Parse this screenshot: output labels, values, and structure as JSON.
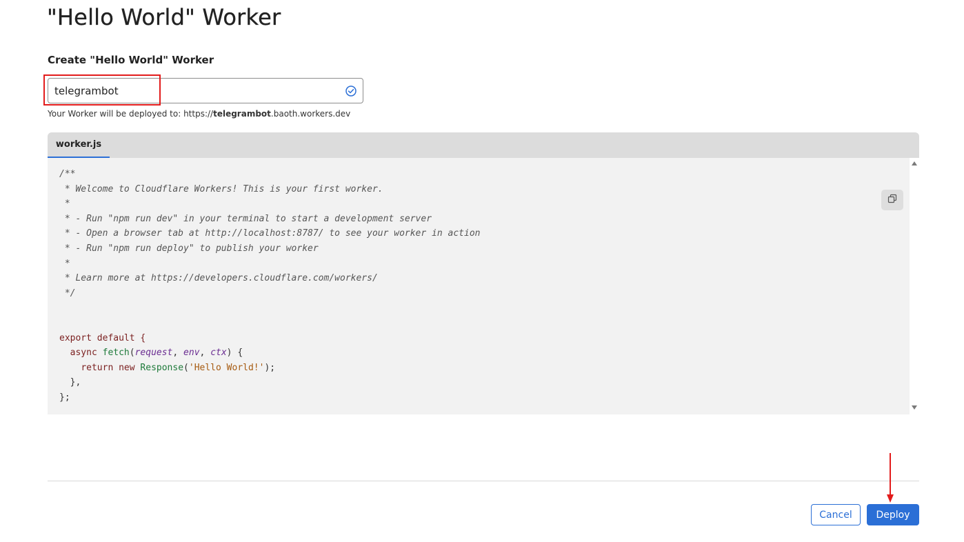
{
  "page": {
    "title": "\"Hello World\" Worker"
  },
  "form": {
    "section_label": "Create \"Hello World\" Worker",
    "worker_name_value": "telegrambot",
    "deploy_url_prefix": "Your Worker will be deployed to: https://",
    "deploy_url_name": "telegrambot",
    "deploy_url_suffix": ".baoth.workers.dev"
  },
  "editor": {
    "tab_label": "worker.js",
    "code_lines": [
      "/**",
      " * Welcome to Cloudflare Workers! This is your first worker.",
      " *",
      " * - Run \"npm run dev\" in your terminal to start a development server",
      " * - Open a browser tab at http://localhost:8787/ to see your worker in action",
      " * - Run \"npm run deploy\" to publish your worker",
      " *",
      " * Learn more at https://developers.cloudflare.com/workers/",
      " */",
      "",
      "",
      "export default {",
      "  async fetch(request, env, ctx) {",
      "    return new Response('Hello World!');",
      "  },",
      "};"
    ]
  },
  "actions": {
    "cancel_label": "Cancel",
    "deploy_label": "Deploy"
  },
  "icons": {
    "valid": "check-circle-icon",
    "copy": "copy-icon"
  },
  "colors": {
    "accent": "#2b6fd6",
    "annotation": "#e21b1b"
  }
}
